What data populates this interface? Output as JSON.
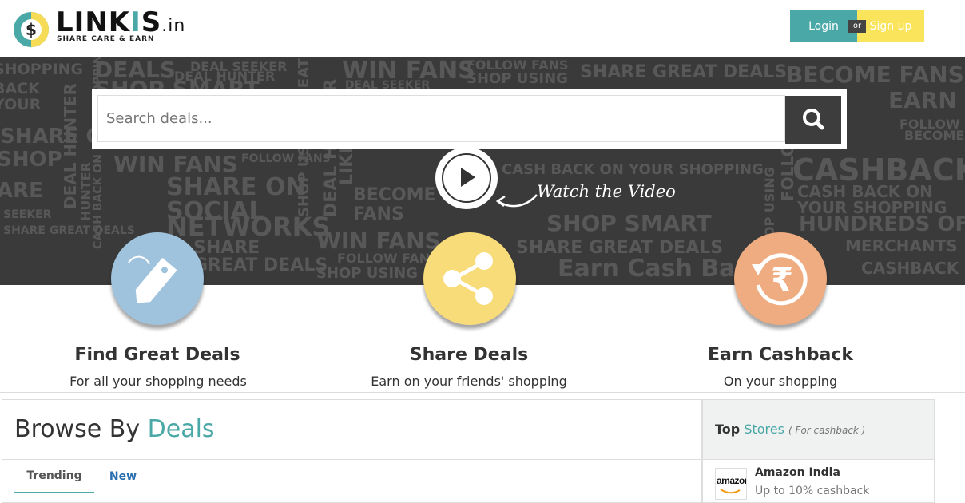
{
  "header": {
    "logo": {
      "word_a": "LINK",
      "word_b": "I",
      "word_c": "S",
      "tld": ".in",
      "tagline": "SHARE  CARE & EARN"
    },
    "login_label": "Login",
    "or_label": "or",
    "signup_label": "Sign up"
  },
  "hero": {
    "search": {
      "placeholder": "Search deals..."
    },
    "watch_label": "Watch the Video",
    "background_words": [
      "DEALS",
      "DEAL SEEKER",
      "DEAL HUNTER",
      "SHOP SMART",
      "WIN FANS",
      "FOLLOW FANS",
      "SHOP USING",
      "SHARE GREAT DEALS",
      "BECOME FANS",
      "EARN",
      "CASHBACK",
      "CASH BACK ON",
      "YOUR SHOPPING",
      "HUNDREDS OF",
      "MERCHANTS",
      "SHARE ON",
      "SOCIAL",
      "NETWORKS",
      "SHARE",
      "GREAT DEALS",
      "Earn Cash Back",
      "BECOME",
      "FANS",
      "LIKE",
      "FOLLOW",
      "HUNTER",
      "CASH BACK ON YOUR SHOPPING",
      "SHOP USING GREAT",
      "ARE",
      "SHOP",
      "SEEKER",
      "BACK",
      "YOUR",
      "SHOPPING"
    ]
  },
  "features": [
    {
      "title": "Find Great Deals",
      "subtitle": "For all your shopping needs",
      "icon": "tag-icon",
      "color": "#9fc3dd"
    },
    {
      "title": "Share Deals",
      "subtitle": "Earn on your friends' shopping",
      "icon": "share-icon",
      "color": "#f8dc7a"
    },
    {
      "title": "Earn Cashback",
      "subtitle": "On your shopping",
      "icon": "rupee-refresh-icon",
      "color": "#efac80"
    }
  ],
  "browse": {
    "title_a": "Browse By",
    "title_b": "Deals",
    "tabs": [
      "Trending",
      "New"
    ]
  },
  "stores": {
    "title_a": "Top",
    "title_b": "Stores",
    "note": "( For cashback )",
    "items": [
      {
        "logo_text": "amazon",
        "name": "Amazon India",
        "cashback": "Up to 10% cashback"
      }
    ]
  },
  "colors": {
    "accent": "#4aa8a7",
    "signup": "#f9e45b",
    "hero_bg": "#3a3a3a",
    "link": "#2a6fb0"
  }
}
